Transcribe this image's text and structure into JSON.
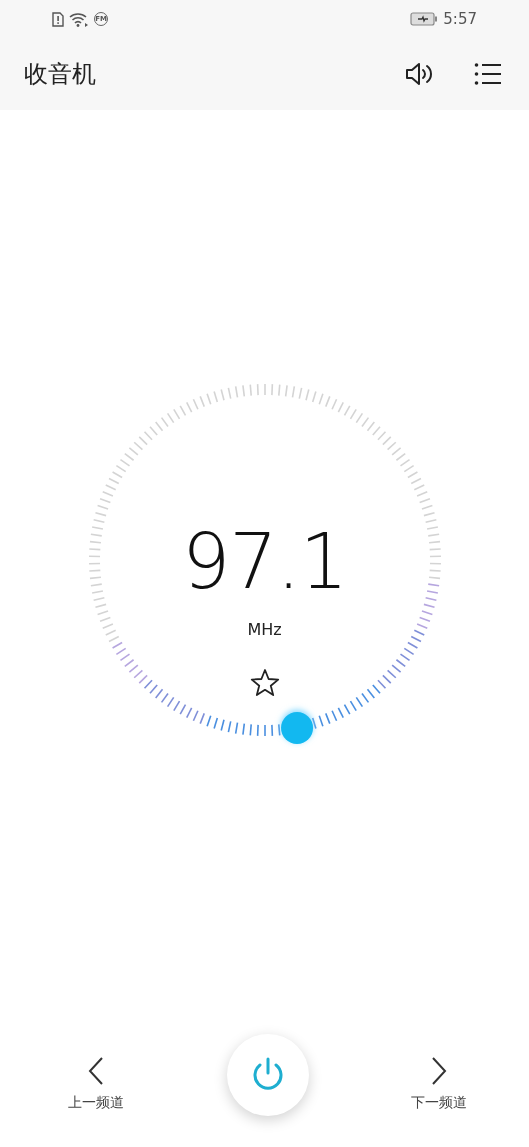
{
  "status_bar": {
    "fm_badge": "FM",
    "time": "5:57"
  },
  "app_bar": {
    "title": "收音机"
  },
  "tuner": {
    "frequency": "97.1",
    "unit": "MHz",
    "favorite": false
  },
  "controls": {
    "previous": {
      "label": "上一频道"
    },
    "power_on": true,
    "next": {
      "label": "下一频道"
    }
  }
}
